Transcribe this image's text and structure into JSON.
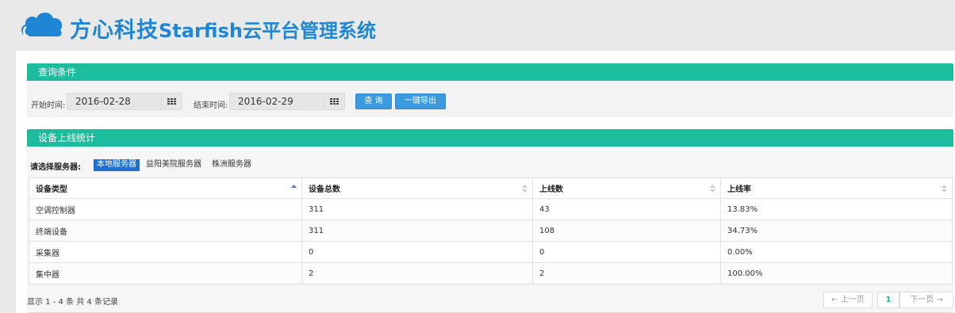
{
  "header": {
    "brand_cn": "方心科技",
    "brand_rest": "Starfish云平台管理系统",
    "logo_icon": "cloud-icon",
    "brand_color": "#1f86d6"
  },
  "query_panel": {
    "title": "查询条件",
    "start_label": "开始时间:",
    "start_value": "2016-02-28",
    "end_label": "结束时间:",
    "end_value": "2016-02-29",
    "calendar_icon": "calendar-icon",
    "search_button": "查 询",
    "export_button": "一键导出"
  },
  "stats_panel": {
    "title": "设备上线统计",
    "server_label": "请选择服务器:",
    "servers": [
      "本地服务器",
      "益阳美院服务器",
      "株洲服务器"
    ],
    "active_server": "本地服务器",
    "columns": [
      "设备类型",
      "设备总数",
      "上线数",
      "上线率"
    ],
    "rows": [
      [
        "空调控制器",
        "311",
        "43",
        "13.83%"
      ],
      [
        "终端设备",
        "311",
        "108",
        "34.73%"
      ],
      [
        "采集器",
        "0",
        "0",
        "0.00%"
      ],
      [
        "集中器",
        "2",
        "2",
        "100.00%"
      ]
    ],
    "summary": "显示 1 - 4 条 共 4 条记录",
    "pager": {
      "prev": "← 上一页",
      "current": "1",
      "next": "下一页 →"
    }
  },
  "colors": {
    "panel_header": "#1cbc9c",
    "button": "#3c9ae0",
    "active_tab": "#1f6fd0"
  }
}
